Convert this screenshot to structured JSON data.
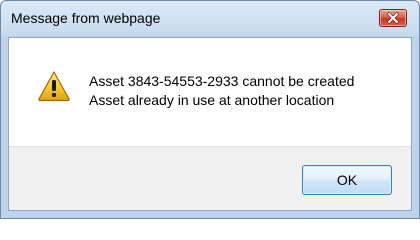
{
  "window": {
    "title": "Message from webpage"
  },
  "dialog": {
    "icon": "warning-icon",
    "message_line1": "Asset 3843-54553-2933 cannot be created",
    "message_line2": "Asset already in use at another location",
    "ok_label": "OK"
  },
  "colors": {
    "close_button": "#c33a22",
    "warning_yellow": "#f4c430",
    "ok_button_border": "#3c7fb1",
    "footer_background": "#f0f0f0"
  }
}
